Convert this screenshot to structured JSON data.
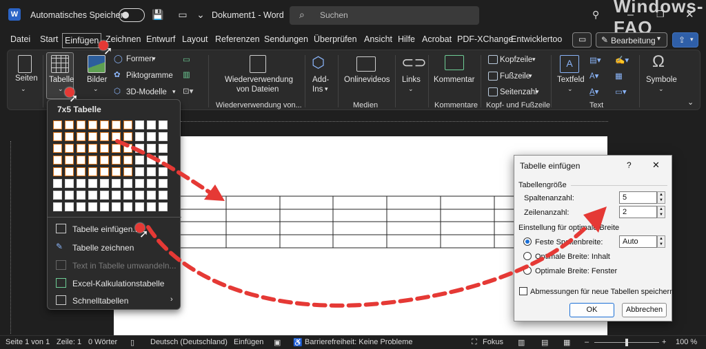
{
  "title_bar": {
    "autosave_label": "Automatisches Speichern",
    "doc_title": "Dokument1 - Word",
    "search_placeholder": "Suchen",
    "watermark": "Windows-FAQ"
  },
  "tabs": [
    "Datei",
    "Start",
    "Einfügen",
    "Zeichnen",
    "Entwurf",
    "Layout",
    "Referenzen",
    "Sendungen",
    "Überprüfen",
    "Ansicht",
    "Hilfe",
    "Acrobat",
    "PDF-XChange",
    "Entwicklertoo"
  ],
  "tab_right": {
    "edit_mode": "Bearbeitung"
  },
  "ribbon": {
    "seiten": "Seiten",
    "tabelle": "Tabelle",
    "bilder": "Bilder",
    "formen": "Formen",
    "piktogramme": "Piktogramme",
    "modelle3d": "3D-Modelle",
    "wiederverwendung_line1": "Wiederverwendung",
    "wiederverwendung_line2": "von Dateien",
    "addins_line1": "Add-",
    "addins_line2": "Ins",
    "onlinevideos": "Onlinevideos",
    "links": "Links",
    "kommentar": "Kommentar",
    "kopfzeile": "Kopfzeile",
    "fusszeile": "Fußzeile",
    "seitenzahl": "Seitenzahl",
    "textfeld": "Textfeld",
    "symbole": "Symbole",
    "groups": {
      "wiederverwendung": "Wiederverwendung von...",
      "medien": "Medien",
      "kommentare": "Kommentare",
      "kopf_fuss": "Kopf- und Fußzeile",
      "text": "Text"
    }
  },
  "dropdown": {
    "grid_label": "7x5 Tabelle",
    "items": [
      {
        "label": "Tabelle einfügen...",
        "disabled": false
      },
      {
        "label": "Tabelle zeichnen",
        "disabled": false
      },
      {
        "label": "Text in Tabelle umwandeln...",
        "disabled": true
      },
      {
        "label": "Excel-Kalkulationstabelle",
        "disabled": false
      },
      {
        "label": "Schnelltabellen",
        "disabled": false
      }
    ]
  },
  "dialog": {
    "title": "Tabelle einfügen",
    "help": "?",
    "close": "✕",
    "section_size": "Tabellengröße",
    "cols_label": "Spaltenanzahl:",
    "cols_value": "5",
    "rows_label": "Zeilenanzahl:",
    "rows_value": "2",
    "section_fit": "Einstellung für optimale Breite",
    "opt_fixed": "Feste Spaltenbreite:",
    "opt_fixed_value": "Auto",
    "opt_content": "Optimale Breite: Inhalt",
    "opt_window": "Optimale Breite: Fenster",
    "remember": "Abmessungen für neue Tabellen speichern",
    "ok": "OK",
    "cancel": "Abbrechen"
  },
  "status": {
    "page": "Seite 1 von 1",
    "line": "Zeile: 1",
    "words": "0 Wörter",
    "language": "Deutsch (Deutschland)",
    "mode": "Einfügen",
    "accessibility": "Barrierefreiheit: Keine Probleme",
    "focus": "Fokus",
    "zoom": "100 %"
  },
  "colors": {
    "accent": "#e07a1f",
    "arrow": "#e53935",
    "dialog_focus": "#1a6fd6"
  }
}
